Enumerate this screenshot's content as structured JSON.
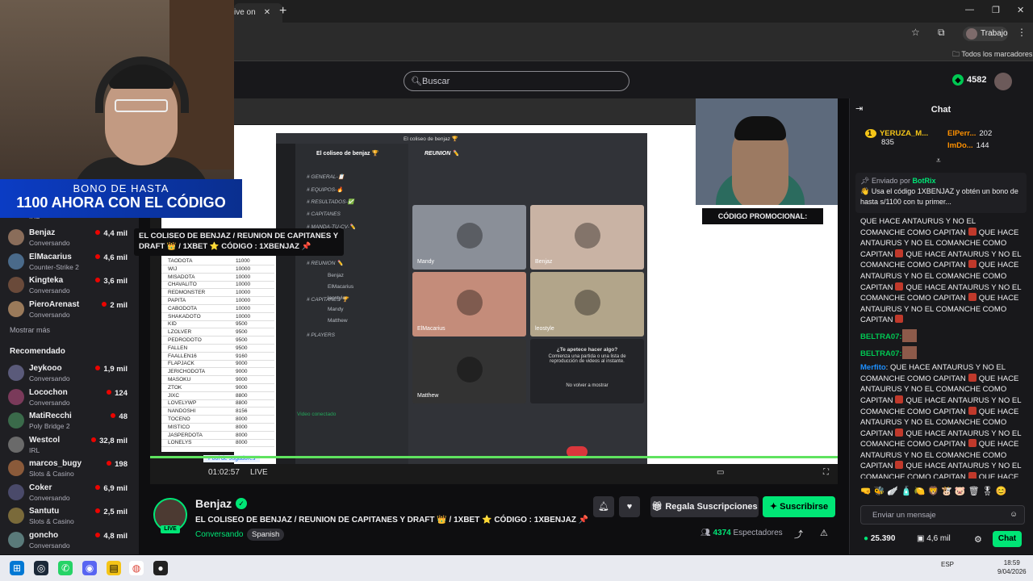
{
  "browser": {
    "tab_label": "ive on",
    "new_tab": "+",
    "profile_label": "Trabajo",
    "bookmarks_label": "Todos los marcadores"
  },
  "header": {
    "search_placeholder": "Buscar",
    "bits": "4582"
  },
  "webcam": {
    "bonus_line1": "BONO DE HASTA",
    "bonus_line2": "1100 AHORA CON EL CÓDIGO"
  },
  "tooltip": "EL COLISEO DE BENJAZ / REUNION DE CAPITANES Y DRAFT 👑 / 1XBET ⭐ CÓDIGO : 1XBENJAZ 📌",
  "sidebar": {
    "followed": [
      {
        "name": "Benjaz",
        "game": "Conversando",
        "viewers": "4,4 mil",
        "live_color": "red"
      },
      {
        "name": "ElMacarius",
        "game": "Counter-Strike 2",
        "viewers": "4,6 mil"
      },
      {
        "name": "Kingteka",
        "game": "Conversando",
        "viewers": "3,6 mil"
      },
      {
        "name": "PieroArenast",
        "game": "Conversando",
        "viewers": "2 mil"
      }
    ],
    "irl_label": "IRL",
    "show_more": "Mostrar más",
    "recommended_title": "Recomendado",
    "recommended": [
      {
        "name": "Jeykooo",
        "game": "Conversando",
        "viewers": "1,9 mil"
      },
      {
        "name": "Locochon",
        "game": "Conversando",
        "viewers": "124"
      },
      {
        "name": "MatiRecchi",
        "game": "Poly Bridge 2",
        "viewers": "48"
      },
      {
        "name": "Westcol",
        "game": "IRL",
        "viewers": "32,8 mil"
      },
      {
        "name": "marcos_bugy",
        "game": "Slots & Casino",
        "viewers": "198"
      },
      {
        "name": "Coker",
        "game": "Conversando",
        "viewers": "6,9 mil"
      },
      {
        "name": "Santutu",
        "game": "Slots & Casino",
        "viewers": "2,5 mil"
      },
      {
        "name": "goncho",
        "game": "Conversando",
        "viewers": "4,8 mil"
      }
    ]
  },
  "video": {
    "discord_window_title": "El coliseo de benjaz 🏆",
    "server_name": "El coliseo de benjaz 🏆",
    "voice_channel": "REUNION ✏️",
    "channels": [
      "GENERAL-📋",
      "EQUIPOS-🔥",
      "RESULTADOS-✅",
      "CAPITANES",
      "MANDA-TU-CV-✏️",
      "REUNION ✏️",
      "CAPITANES 🏆",
      "PLAYERS"
    ],
    "voice_members": [
      "Benjaz",
      "ElMacarius",
      "leostyle",
      "Mandy",
      "Matthew"
    ],
    "tiles": [
      "Mandy",
      "Benjaz",
      "ElMacarius",
      "leostyle",
      "Matthew"
    ],
    "invite_title": "¿Te apetece hacer algo?",
    "invite_body": "Comienza una partida o una lista de reproducción de videos al instante.",
    "invite_check": "No volver a mostrar",
    "video_connected": "Video conectado",
    "sheet_tab": "Pool de Jugadores",
    "sheet_rows": [
      [
        "TAODOTA",
        "11000"
      ],
      [
        "WIJ",
        "10000"
      ],
      [
        "MISADOTA",
        "10000"
      ],
      [
        "CHAVALITO",
        "10000"
      ],
      [
        "REDMONSTER",
        "10000"
      ],
      [
        "PAPITA",
        "10000"
      ],
      [
        "CABODOTA",
        "10000"
      ],
      [
        "SHAKADOTO",
        "10000"
      ],
      [
        "KID",
        "9500"
      ],
      [
        "LZOLVER",
        "9500"
      ],
      [
        "PEDRODOTO",
        "9500"
      ],
      [
        "FALLEN",
        "9500"
      ],
      [
        "FAALLEN16",
        "9160"
      ],
      [
        "FLAPJACK",
        "9000"
      ],
      [
        "JERICHODOTA",
        "9000"
      ],
      [
        "MASOKU",
        "9000"
      ],
      [
        "ZTOK",
        "9000"
      ],
      [
        "JIXC",
        "8800"
      ],
      [
        "LOVELYWP",
        "8800"
      ],
      [
        "NANDOSHI",
        "8156"
      ],
      [
        "TOCENO",
        "8000"
      ],
      [
        "MISTICO",
        "8000"
      ],
      [
        "JASPERDOTA",
        "8000"
      ],
      [
        "LONELYS",
        "8000"
      ]
    ],
    "promo_label": "CÓDIGO PROMOCIONAL:",
    "live_label": "LIVE",
    "elapsed": "01:02:57",
    "progress_pct": 100
  },
  "stream": {
    "name": "Benjaz",
    "title": "EL COLISEO DE BENJAZ / REUNION DE CAPITANES Y DRAFT 👑 / 1XBET ⭐ CÓDIGO : 1XBENJAZ 📌",
    "category": "Conversando",
    "language": "Spanish",
    "live_badge": "LIVE",
    "gift_label": "Regala Suscripciones",
    "sub_label": "Suscribirse",
    "viewers_count": "4374",
    "viewers_label": "Espectadores"
  },
  "chat": {
    "title": "Chat",
    "leaderboard": [
      {
        "name": "YERUZA_M...",
        "score": "835"
      },
      {
        "name": "ElPerr...",
        "score": "202"
      },
      {
        "name": "ImDo...",
        "score": "144"
      }
    ],
    "pinned_by": "Enviado por",
    "pinned_user": "BotRix",
    "pinned_text": "👋 Usa el código 1XBENJAZ y obtén un bono de hasta s/1100 con tu primer...",
    "spam_line": "QUE HACE ANTAURUS Y NO EL COMANCHE COMO CAPITAN",
    "user_beltra": "BELTRA07:",
    "user_merfito": "Merfito",
    "input_placeholder": "Enviar un mensaje",
    "points": "25.390",
    "points2": "4,6 mil",
    "send_label": "Chat"
  },
  "taskbar": {
    "lang": "ESP",
    "time": "18:59",
    "date": "9/04/2026"
  },
  "colors": {
    "accent": "#00e676",
    "bg": "#0e0e10",
    "panel": "#18181b"
  }
}
